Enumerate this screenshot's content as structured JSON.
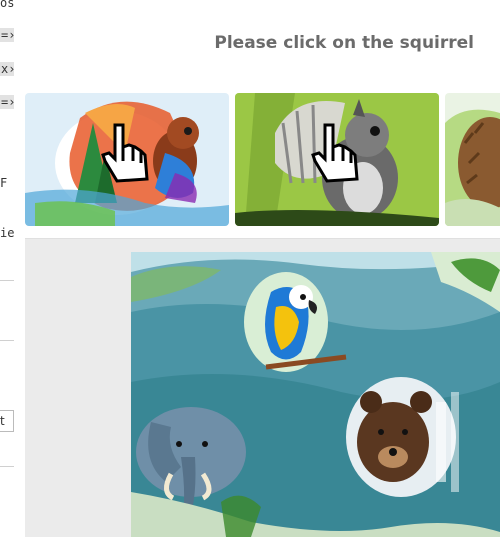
{
  "left_fragment": {
    "items": [
      "os",
      "=›",
      "x›",
      "=›",
      "F",
      "ie",
      "t"
    ]
  },
  "prompt": {
    "text": "Please click on the squirrel"
  },
  "thumbnails": [
    {
      "subject": "squirrel",
      "style": "colorful watercolor"
    },
    {
      "subject": "squirrel",
      "style": "grey on green"
    },
    {
      "subject": "hedgehog",
      "style": "watercolor"
    }
  ],
  "scene": {
    "animals": [
      "parrot",
      "elephant",
      "bear"
    ]
  },
  "colors": {
    "prompt_text": "#6b6b6b",
    "scene_background": "#ebebeb"
  }
}
